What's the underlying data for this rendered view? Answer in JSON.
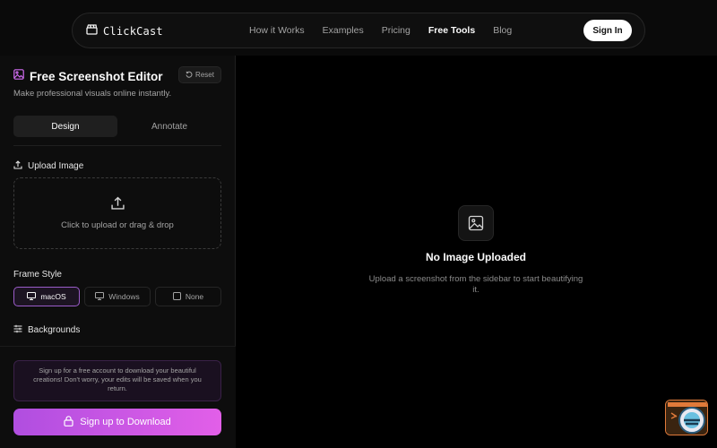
{
  "brand": {
    "name": "ClickCast",
    "logo_icon": "clapperboard-icon"
  },
  "nav": {
    "links": [
      {
        "label": "How it Works",
        "active": false
      },
      {
        "label": "Examples",
        "active": false
      },
      {
        "label": "Pricing",
        "active": false
      },
      {
        "label": "Free Tools",
        "active": true
      },
      {
        "label": "Blog",
        "active": false
      }
    ],
    "signin_label": "Sign In"
  },
  "sidebar": {
    "title": "Free Screenshot Editor",
    "reset_label": "Reset",
    "subtitle": "Make professional visuals online instantly.",
    "tabs": [
      {
        "label": "Design",
        "active": true
      },
      {
        "label": "Annotate",
        "active": false
      }
    ],
    "upload": {
      "label": "Upload Image",
      "dropzone_text": "Click to upload or drag & drop"
    },
    "frame_style": {
      "label": "Frame Style",
      "options": [
        {
          "label": "macOS",
          "active": true
        },
        {
          "label": "Windows",
          "active": false
        },
        {
          "label": "None",
          "active": false
        }
      ]
    },
    "backgrounds_label": "Backgrounds",
    "notice": "Sign up for a free account to download your beautiful creations! Don't worry, your edits will be saved when you return.",
    "cta_label": "Sign up to Download"
  },
  "main": {
    "empty_title": "No Image Uploaded",
    "empty_subtitle": "Upload a screenshot from the sidebar to start beautifying it."
  },
  "colors": {
    "accent": "#c455e6",
    "background": "#000000"
  }
}
